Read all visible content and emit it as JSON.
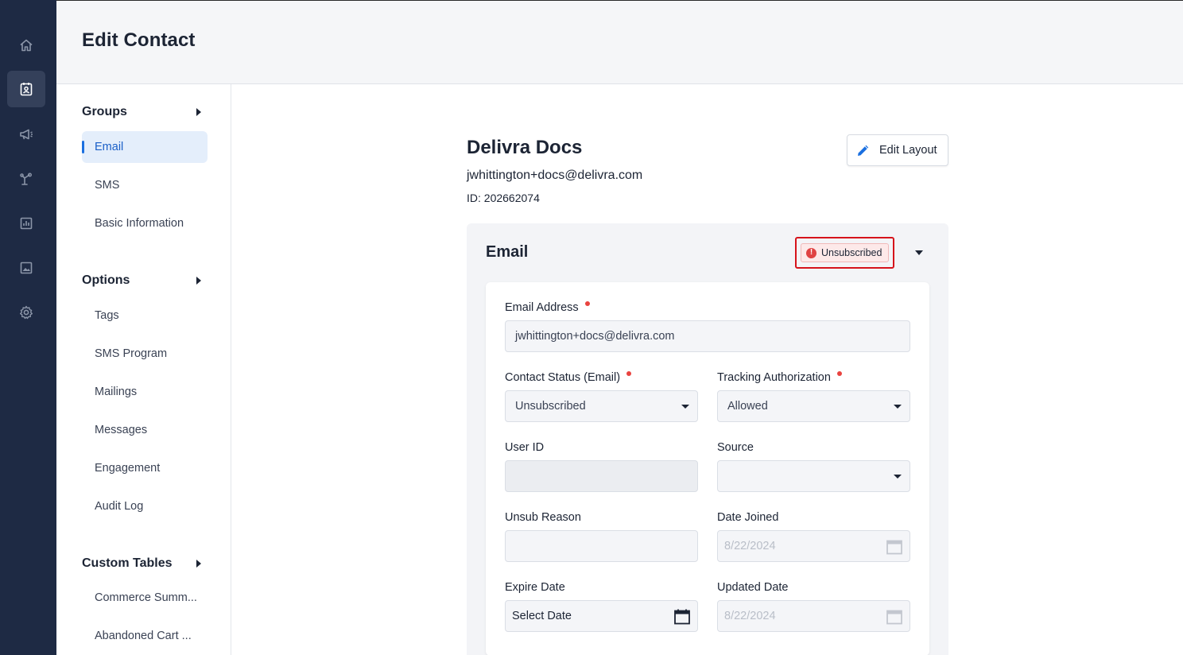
{
  "header": {
    "title": "Edit Contact"
  },
  "rail": {
    "items": [
      {
        "icon": "home-icon"
      },
      {
        "icon": "contacts-icon",
        "active": true
      },
      {
        "icon": "megaphone-icon"
      },
      {
        "icon": "automation-icon"
      },
      {
        "icon": "reports-icon"
      },
      {
        "icon": "image-icon"
      },
      {
        "icon": "gear-icon"
      }
    ]
  },
  "sidebar": {
    "groups_label": "Groups",
    "groups": [
      "Email",
      "SMS",
      "Basic Information"
    ],
    "options_label": "Options",
    "options": [
      "Tags",
      "SMS Program",
      "Mailings",
      "Messages",
      "Engagement",
      "Audit Log"
    ],
    "custom_tables_label": "Custom Tables",
    "custom_tables": [
      "Commerce Summ...",
      "Abandoned Cart ..."
    ]
  },
  "contact": {
    "name": "Delivra Docs",
    "email": "jwhittington+docs@delivra.com",
    "id_text": "ID: 202662074"
  },
  "edit_layout_label": "Edit Layout",
  "email_section": {
    "title": "Email",
    "status_badge": "Unsubscribed",
    "badge_icon": "!",
    "fields": {
      "email_address_label": "Email Address",
      "email_address_value": "jwhittington+docs@delivra.com",
      "contact_status_label": "Contact Status (Email)",
      "contact_status_value": "Unsubscribed",
      "tracking_label": "Tracking Authorization",
      "tracking_value": "Allowed",
      "user_id_label": "User ID",
      "user_id_value": "",
      "source_label": "Source",
      "source_value": "",
      "unsub_reason_label": "Unsub Reason",
      "unsub_reason_value": "",
      "date_joined_label": "Date Joined",
      "date_joined_value": "8/22/2024",
      "expire_date_label": "Expire Date",
      "expire_date_value": "Select Date",
      "updated_date_label": "Updated Date",
      "updated_date_value": "8/22/2024"
    }
  },
  "colors": {
    "rail_bg": "#1e2a44",
    "accent": "#1a6fe0",
    "highlight_border": "#d6131b",
    "required_dot": "#e9433f"
  }
}
